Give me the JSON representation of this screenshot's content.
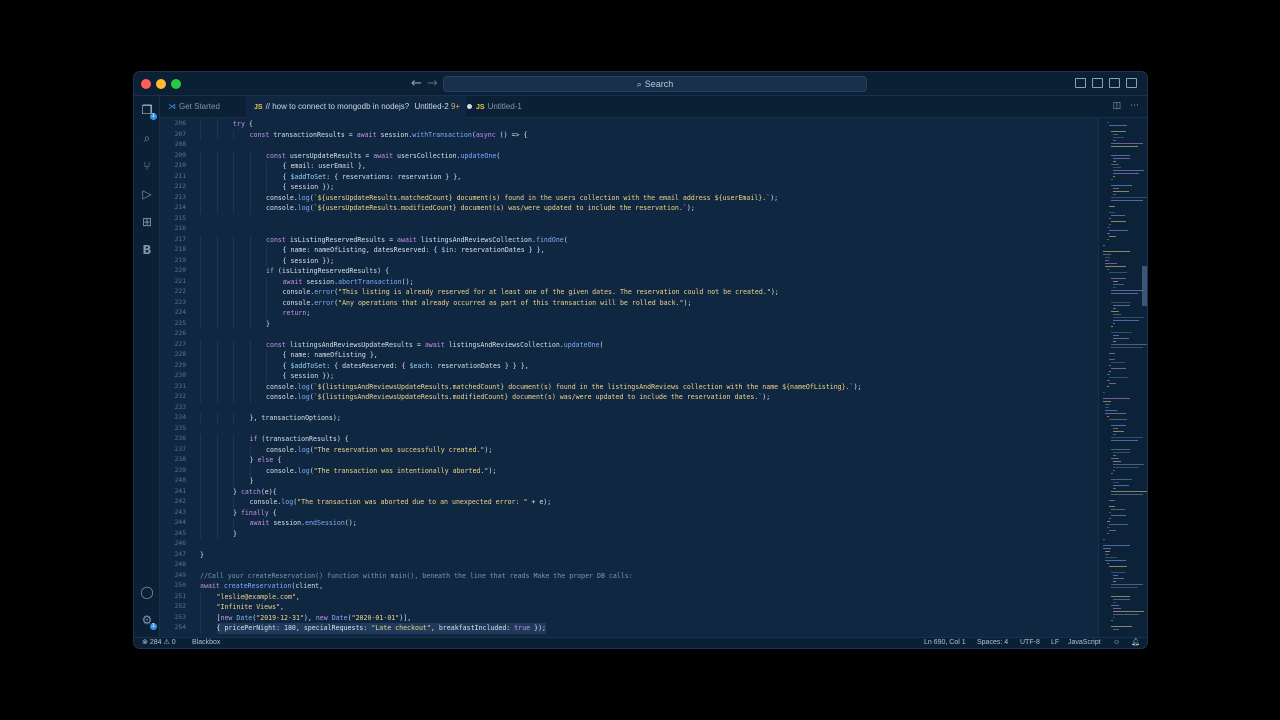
{
  "titlebar": {
    "search_label": "Search"
  },
  "tabs": [
    {
      "icon": "vscode",
      "label": "Get Started"
    },
    {
      "icon": "js",
      "label": "// how to connect to mongodb in nodejs?",
      "extra": "Untitled-2",
      "git": "9+",
      "modified": true
    },
    {
      "icon": "js",
      "label": "Untitled-1"
    }
  ],
  "editor": {
    "lines": [
      {
        "n": "206",
        "indent": 2,
        "text": "try {"
      },
      {
        "n": "207",
        "indent": 3,
        "text": "const transactionResults = await session.withTransaction(async () => {"
      },
      {
        "n": "208",
        "indent": 0,
        "text": ""
      },
      {
        "n": "209",
        "indent": 4,
        "text": "const usersUpdateResults = await usersCollection.updateOne("
      },
      {
        "n": "210",
        "indent": 5,
        "text": "{ email: userEmail },"
      },
      {
        "n": "211",
        "indent": 5,
        "text": "{ $addToSet: { reservations: reservation } },"
      },
      {
        "n": "212",
        "indent": 5,
        "text": "{ session });"
      },
      {
        "n": "213",
        "indent": 4,
        "text": "console.log(`${usersUpdateResults.matchedCount} document(s) found in the users collection with the email address ${userEmail}.`);"
      },
      {
        "n": "214",
        "indent": 4,
        "text": "console.log(`${usersUpdateResults.modifiedCount} document(s) was/were updated to include the reservation.`);"
      },
      {
        "n": "215",
        "indent": 0,
        "text": ""
      },
      {
        "n": "216",
        "indent": 0,
        "text": ""
      },
      {
        "n": "217",
        "indent": 4,
        "text": "const isListingReservedResults = await listingsAndReviewsCollection.findOne("
      },
      {
        "n": "218",
        "indent": 5,
        "text": "{ name: nameOfListing, datesReserved: { $in: reservationDates } },"
      },
      {
        "n": "219",
        "indent": 5,
        "text": "{ session });"
      },
      {
        "n": "220",
        "indent": 4,
        "text": "if (isListingReservedResults) {"
      },
      {
        "n": "221",
        "indent": 5,
        "text": "await session.abortTransaction();"
      },
      {
        "n": "222",
        "indent": 5,
        "text": "console.error(\"This listing is already reserved for at least one of the given dates. The reservation could not be created.\");"
      },
      {
        "n": "223",
        "indent": 5,
        "text": "console.error(\"Any operations that already occurred as part of this transaction will be rolled back.\");"
      },
      {
        "n": "224",
        "indent": 5,
        "text": "return;"
      },
      {
        "n": "225",
        "indent": 4,
        "text": "}"
      },
      {
        "n": "226",
        "indent": 0,
        "text": ""
      },
      {
        "n": "227",
        "indent": 4,
        "text": "const listingsAndReviewsUpdateResults = await listingsAndReviewsCollection.updateOne("
      },
      {
        "n": "228",
        "indent": 5,
        "text": "{ name: nameOfListing },"
      },
      {
        "n": "229",
        "indent": 5,
        "text": "{ $addToSet: { datesReserved: { $each: reservationDates } } },"
      },
      {
        "n": "230",
        "indent": 5,
        "text": "{ session });"
      },
      {
        "n": "231",
        "indent": 4,
        "text": "console.log(`${listingsAndReviewsUpdateResults.matchedCount} document(s) found in the listingsAndReviews collection with the name ${nameOfListing}.`);"
      },
      {
        "n": "232",
        "indent": 4,
        "text": "console.log(`${listingsAndReviewsUpdateResults.modifiedCount} document(s) was/were updated to include the reservation dates.`);"
      },
      {
        "n": "233",
        "indent": 0,
        "text": ""
      },
      {
        "n": "234",
        "indent": 3,
        "text": "}, transactionOptions);"
      },
      {
        "n": "235",
        "indent": 0,
        "text": ""
      },
      {
        "n": "236",
        "indent": 3,
        "text": "if (transactionResults) {"
      },
      {
        "n": "237",
        "indent": 4,
        "text": "console.log(\"The reservation was successfully created.\");"
      },
      {
        "n": "238",
        "indent": 3,
        "text": "} else {"
      },
      {
        "n": "239",
        "indent": 4,
        "text": "console.log(\"The transaction was intentionally aborted.\");"
      },
      {
        "n": "240",
        "indent": 3,
        "text": "}"
      },
      {
        "n": "241",
        "indent": 2,
        "text": "} catch(e){"
      },
      {
        "n": "242",
        "indent": 3,
        "text": "console.log(\"The transaction was aborted due to an unexpected error: \" + e);"
      },
      {
        "n": "243",
        "indent": 2,
        "text": "} finally {"
      },
      {
        "n": "244",
        "indent": 3,
        "text": "await session.endSession();"
      },
      {
        "n": "245",
        "indent": 2,
        "text": "}"
      },
      {
        "n": "246",
        "indent": 0,
        "text": ""
      },
      {
        "n": "247",
        "indent": 0,
        "text": "}"
      },
      {
        "n": "248",
        "indent": 0,
        "text": ""
      },
      {
        "n": "249",
        "indent": 0,
        "text": "//Call your createReservation() function within main(), beneath the line that reads Make the proper DB calls:"
      },
      {
        "n": "250",
        "indent": 0,
        "text": "await createReservation(client,"
      },
      {
        "n": "251",
        "indent": 1,
        "text": "\"leslie@example.com\","
      },
      {
        "n": "252",
        "indent": 1,
        "text": "\"Infinite Views\","
      },
      {
        "n": "253",
        "indent": 1,
        "text": "[new Date(\"2019-12-31\"), new Date(\"2020-01-01\")],"
      },
      {
        "n": "254",
        "indent": 1,
        "text": "{ pricePerNight: 180, specialRequests: \"Late checkout\", breakfastIncluded: true });",
        "selected": true
      }
    ]
  },
  "statusbar": {
    "errors": "284",
    "warnings": "0",
    "extension": "Blackbox",
    "cursor": "Ln 690, Col 1",
    "spaces": "Spaces: 4",
    "encoding": "UTF-8",
    "eol": "LF",
    "language": "JavaScript"
  },
  "colors": {
    "keyword": "#c792ea",
    "function": "#82aaff",
    "string": "#f2d58a",
    "comment": "#7f95ad",
    "property": "#9bd4ff",
    "plain": "#d7e0ea"
  }
}
